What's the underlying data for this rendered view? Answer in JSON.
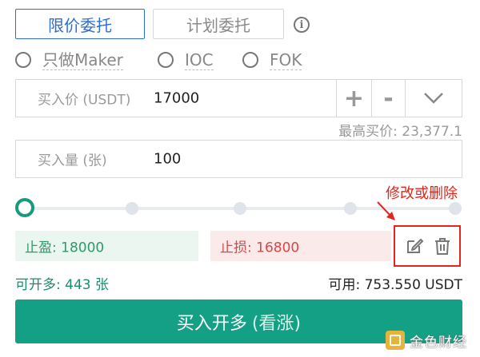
{
  "tabs": {
    "limit_label": "限价委托",
    "plan_label": "计划委托"
  },
  "options": {
    "maker_label": "只做Maker",
    "ioc_label": "IOC",
    "fok_label": "FOK"
  },
  "price_field": {
    "label": "买入价 (USDT)",
    "value": "17000",
    "plus": "+",
    "minus": "-"
  },
  "max_buy": {
    "text": "最高买价: 23,377.1"
  },
  "amount_field": {
    "label": "买入量 (张)",
    "value": "100"
  },
  "slider": {
    "level": 0,
    "stops": 5
  },
  "annotation": {
    "text": "修改或删除"
  },
  "tp_sl": {
    "take_profit": "止盈: 18000",
    "stop_loss": "止损: 16800"
  },
  "can_open": {
    "text": "可开多: 443 张"
  },
  "available": {
    "text": "可用: 753.550 USDT"
  },
  "buy_button": {
    "label": "买入开多",
    "note": "(看涨)"
  },
  "watermark": {
    "text": "金色财经"
  },
  "colors": {
    "accent_blue": "#2b6fd6",
    "buy_green": "#14a085",
    "stop_red": "#d74848",
    "annotation_red": "#e0261d"
  },
  "icons": [
    "info-icon",
    "chevron-down-icon",
    "edit-icon",
    "trash-icon"
  ]
}
